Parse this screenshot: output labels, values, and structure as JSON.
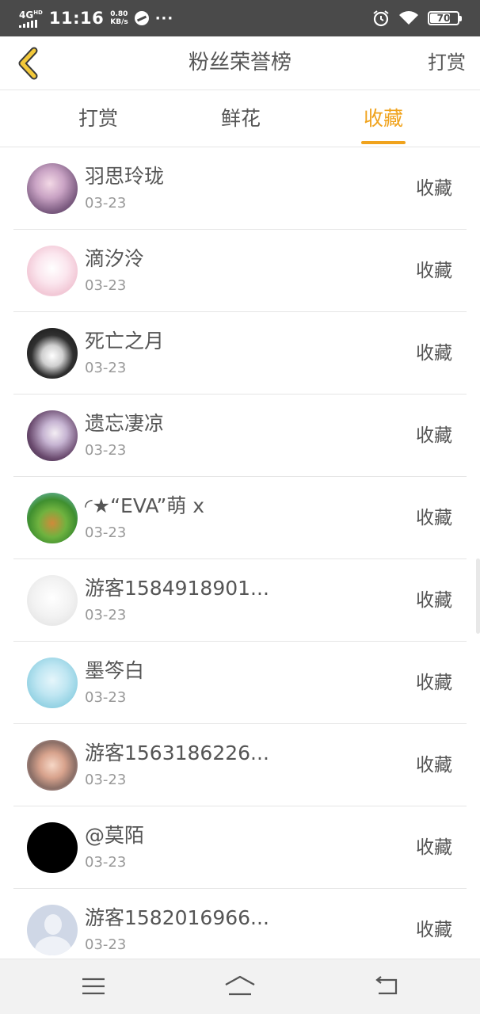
{
  "status_bar": {
    "network": "4G",
    "network_sup": "HD",
    "time": "11:16",
    "speed_value": "0.80",
    "speed_unit": "KB/s",
    "dots": "···",
    "battery_level": "70",
    "icons": [
      "signal-icon",
      "app-notification-icon",
      "alarm-icon",
      "wifi-icon",
      "battery-icon"
    ]
  },
  "header": {
    "back_icon": "back-chevron-icon",
    "title": "粉丝荣誉榜",
    "action_label": "打赏"
  },
  "tabs": {
    "items": [
      {
        "label": "打赏",
        "active": false
      },
      {
        "label": "鲜花",
        "active": false
      },
      {
        "label": "收藏",
        "active": true
      }
    ],
    "accent_color": "#f0a31d"
  },
  "list": {
    "items": [
      {
        "name": "羽思玲珑",
        "date": "03-23",
        "action": "收藏"
      },
      {
        "name": "滴汐泠",
        "date": "03-23",
        "action": "收藏"
      },
      {
        "name": "死亡之月",
        "date": "03-23",
        "action": "收藏"
      },
      {
        "name": "遗忘凄凉",
        "date": "03-23",
        "action": "收藏"
      },
      {
        "name": "◜★“EVA”萌 x",
        "date": "03-23",
        "action": "收藏"
      },
      {
        "name": "游客1584918901...",
        "date": "03-23",
        "action": "收藏"
      },
      {
        "name": "墨笒白",
        "date": "03-23",
        "action": "收藏"
      },
      {
        "name": "游客1563186226...",
        "date": "03-23",
        "action": "收藏"
      },
      {
        "name": "@莫陌",
        "date": "03-23",
        "action": "收藏"
      },
      {
        "name": "游客1582016966...",
        "date": "03-23",
        "action": "收藏"
      }
    ]
  },
  "bottom_nav": {
    "icons": [
      "menu-icon",
      "home-icon",
      "back-icon"
    ]
  }
}
